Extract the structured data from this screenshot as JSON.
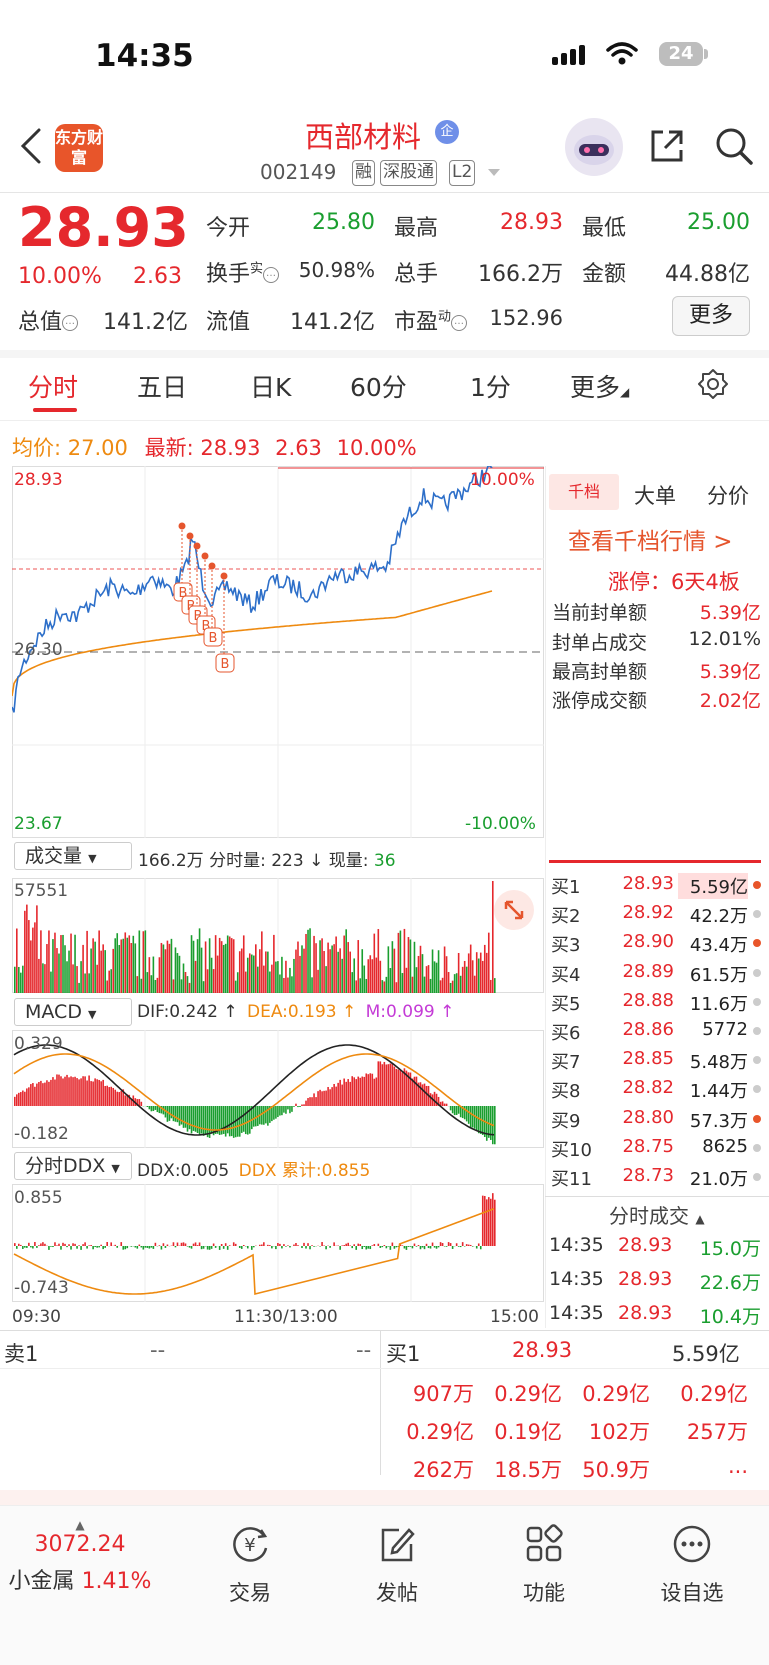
{
  "status": {
    "time": "14:35",
    "battery": "24"
  },
  "nav": {
    "logo": "东方财富",
    "stock_name": "西部材料",
    "enterprise_badge": "企",
    "code": "002149",
    "tags": [
      "融",
      "深股通",
      "L2"
    ]
  },
  "quote": {
    "last_price": "28.93",
    "pct_change": "10.00%",
    "amt_change": "2.63",
    "fields": {
      "open_label": "今开",
      "open": "25.80",
      "high_label": "最高",
      "high": "28.93",
      "low_label": "最低",
      "low": "25.00",
      "turnover_label": "换手",
      "turnover_sup": "实",
      "turnover": "50.98%",
      "volume_label": "总手",
      "volume": "166.2万",
      "amount_label": "金额",
      "amount": "44.88亿",
      "mktcap_label": "总值",
      "mktcap": "141.2亿",
      "float_label": "流值",
      "float": "141.2亿",
      "pe_label": "市盈",
      "pe_sup": "动",
      "pe": "152.96"
    },
    "more_button": "更多"
  },
  "tabs": [
    "分时",
    "五日",
    "日K",
    "60分",
    "1分",
    "更多"
  ],
  "avg_line": {
    "avg_label": "均价:",
    "avg": "27.00",
    "latest_label": "最新:",
    "latest": "28.93",
    "chg": "2.63",
    "pct": "10.00%"
  },
  "price_chart": {
    "top_price": "28.93",
    "top_pct": "10.00%",
    "mid_price": "26.30",
    "bottom_price": "23.67",
    "bottom_pct": "-10.00%",
    "marker": "B"
  },
  "volume_panel": {
    "selector": "成交量",
    "total": "166.2万",
    "fenshi_label": "分时量:",
    "fenshi_val": "223",
    "arrow": "↓",
    "now_label": "现量:",
    "now_val": "36",
    "max": "57551"
  },
  "macd_panel": {
    "selector": "MACD",
    "dif": "DIF:0.242 ↑",
    "dea": "DEA:0.193 ↑",
    "m": "M:0.099 ↑",
    "top": "0.329",
    "bottom": "-0.182"
  },
  "ddx_panel": {
    "selector": "分时DDX",
    "ddx": "DDX:0.005",
    "cum": "DDX 累计:0.855",
    "top": "0.855",
    "bottom": "-0.743"
  },
  "time_axis": [
    "09:30",
    "11:30/13:00",
    "15:00"
  ],
  "right_panel": {
    "tabs": [
      "千档",
      "大单",
      "分价"
    ],
    "view_link": "查看千档行情 >",
    "limit_up": "涨停：6天4板",
    "stats": [
      {
        "label": "当前封单额",
        "value": "5.39亿"
      },
      {
        "label": "封单占成交",
        "value": "12.01%"
      },
      {
        "label": "最高封单额",
        "value": "5.39亿"
      },
      {
        "label": "涨停成交额",
        "value": "2.02亿"
      }
    ],
    "bids": [
      {
        "label": "买1",
        "price": "28.93",
        "vol": "5.59亿",
        "dot": "orange"
      },
      {
        "label": "买2",
        "price": "28.92",
        "vol": "42.2万",
        "dot": "gray"
      },
      {
        "label": "买3",
        "price": "28.90",
        "vol": "43.4万",
        "dot": "orange"
      },
      {
        "label": "买4",
        "price": "28.89",
        "vol": "61.5万",
        "dot": "gray"
      },
      {
        "label": "买5",
        "price": "28.88",
        "vol": "11.6万",
        "dot": "gray"
      },
      {
        "label": "买6",
        "price": "28.86",
        "vol": "5772",
        "dot": "gray"
      },
      {
        "label": "买7",
        "price": "28.85",
        "vol": "5.48万",
        "dot": "gray"
      },
      {
        "label": "买8",
        "price": "28.82",
        "vol": "1.44万",
        "dot": "gray"
      },
      {
        "label": "买9",
        "price": "28.80",
        "vol": "57.3万",
        "dot": "orange"
      },
      {
        "label": "买10",
        "price": "28.75",
        "vol": "8625",
        "dot": "gray"
      },
      {
        "label": "买11",
        "price": "28.73",
        "vol": "21.0万",
        "dot": "gray"
      }
    ],
    "ticks_header": "分时成交",
    "ticks": [
      {
        "time": "14:35",
        "price": "28.93",
        "vol": "15.0万"
      },
      {
        "time": "14:35",
        "price": "28.93",
        "vol": "22.6万"
      },
      {
        "time": "14:35",
        "price": "28.93",
        "vol": "10.4万"
      }
    ]
  },
  "order_book": {
    "sell_label": "卖1",
    "sell_price": "--",
    "sell_vol": "--",
    "buy_label": "买1",
    "buy_price": "28.93",
    "buy_vol": "5.59亿",
    "queue": [
      "907万",
      "0.29亿",
      "0.29亿",
      "0.29亿",
      "0.29亿",
      "0.19亿",
      "102万",
      "257万",
      "262万",
      "18.5万",
      "50.9万",
      "..."
    ]
  },
  "bottom_bar": {
    "index_value": "3072.24",
    "index_name": "小金属",
    "index_pct": "1.41%",
    "items": [
      "交易",
      "发帖",
      "功能",
      "设自选"
    ]
  },
  "colors": {
    "up": "#e5282d",
    "down": "#1a9e2f",
    "avg": "#ee8a10",
    "price": "#2d6fc9"
  }
}
